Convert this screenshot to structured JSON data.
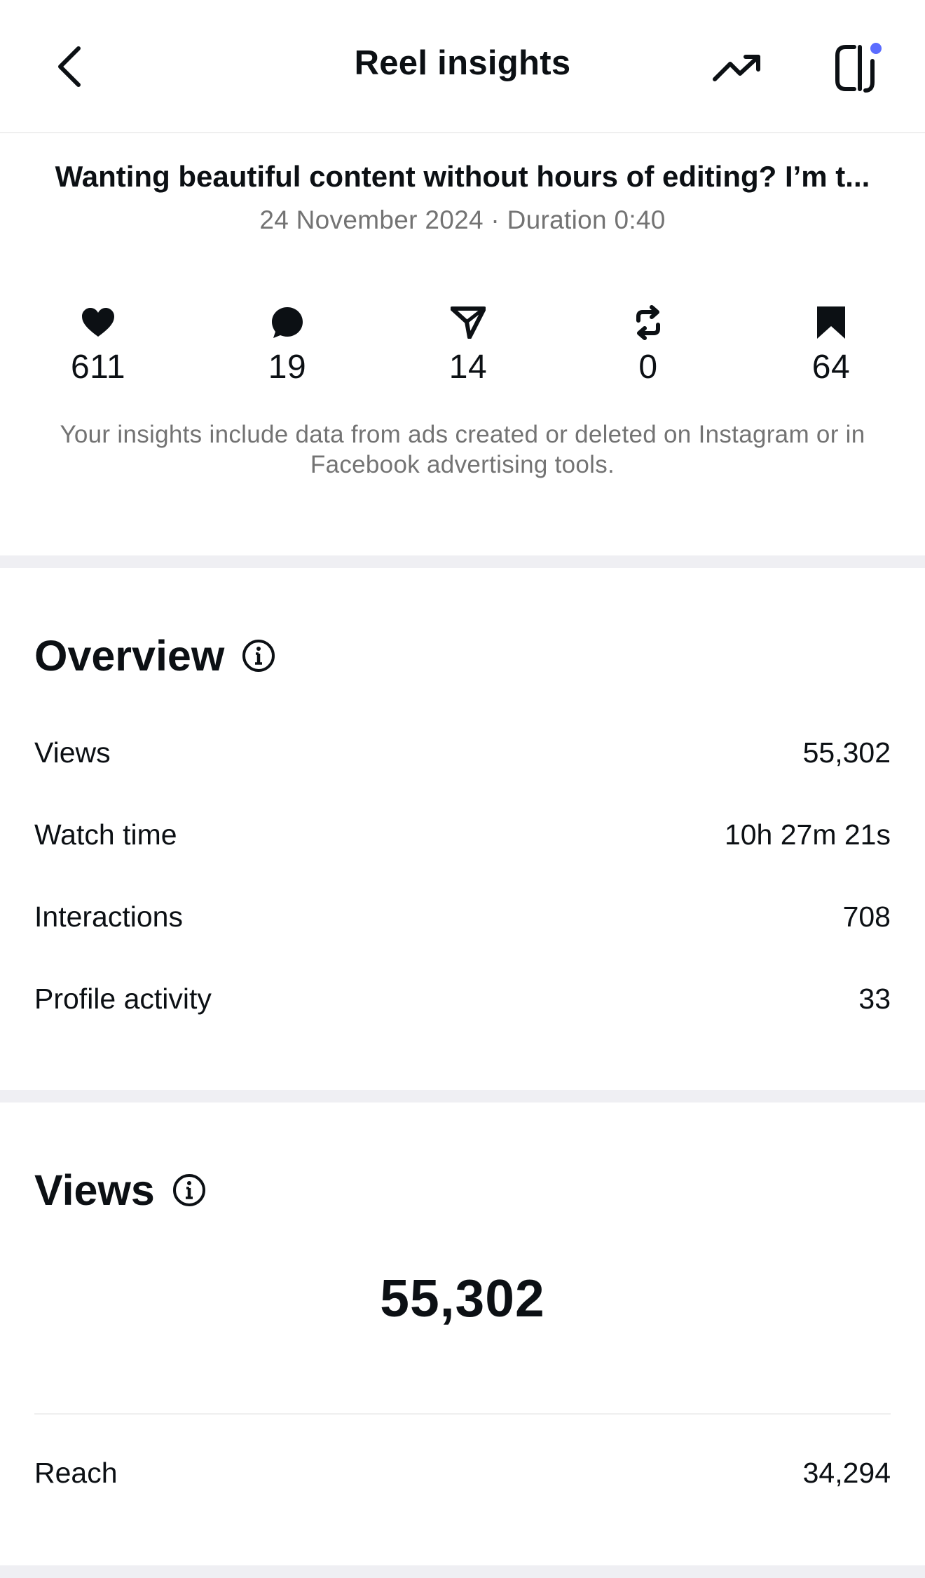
{
  "header": {
    "title": "Reel insights",
    "back_icon": "chevron-left-icon",
    "trend_icon": "trending-up-icon",
    "app_icon": "cj-app-icon",
    "notification_dot_color": "#5b6cff"
  },
  "post": {
    "caption": "Wanting beautiful content without hours of editing? I’m t...",
    "meta": "24 November 2024 · Duration 0:40"
  },
  "stats": [
    {
      "icon": "heart-icon",
      "value": "611"
    },
    {
      "icon": "comment-icon",
      "value": "19"
    },
    {
      "icon": "share-icon",
      "value": "14"
    },
    {
      "icon": "repost-icon",
      "value": "0"
    },
    {
      "icon": "bookmark-icon",
      "value": "64"
    }
  ],
  "note": "Your insights include data from ads created or deleted on Instagram or in Facebook advertising tools.",
  "overview": {
    "title": "Overview",
    "info_icon": "info-icon",
    "rows": [
      {
        "label": "Views",
        "value": "55,302"
      },
      {
        "label": "Watch time",
        "value": "10h 27m 21s"
      },
      {
        "label": "Interactions",
        "value": "708"
      },
      {
        "label": "Profile activity",
        "value": "33"
      }
    ]
  },
  "views": {
    "title": "Views",
    "info_icon": "info-icon",
    "total": "55,302",
    "rows": [
      {
        "label": "Reach",
        "value": "34,294"
      }
    ]
  }
}
